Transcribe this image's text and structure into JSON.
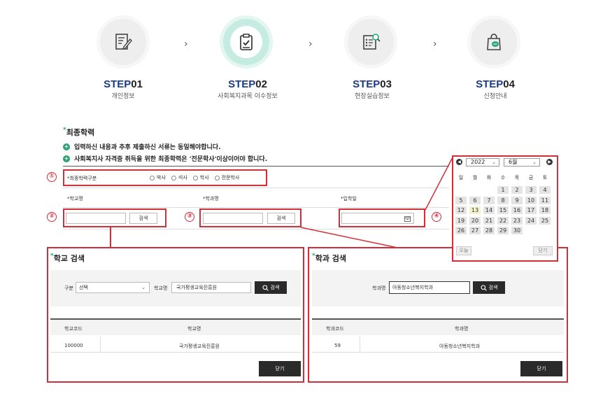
{
  "steps": [
    {
      "label": "STEP",
      "num": "01",
      "sub": "개인정보",
      "icon": "edit-document-icon"
    },
    {
      "label": "STEP",
      "num": "02",
      "sub": "사회복지과목 이수정보",
      "icon": "clipboard-check-icon"
    },
    {
      "label": "STEP",
      "num": "03",
      "sub": "현장실습정보",
      "icon": "document-search-icon"
    },
    {
      "label": "STEP",
      "num": "04",
      "sub": "신청안내",
      "icon": "shopping-bag-chat-icon"
    }
  ],
  "step_chevron": "›",
  "section": {
    "title": "최종학력",
    "required_mark": "*",
    "notices": [
      "입력하신 내용과 추후 제출하신 서류는 동일해야합니다.",
      "사회복지사 자격증 취득을 위한 최종학력은 '전문학사'이상이어야 합니다."
    ]
  },
  "form": {
    "degree_label": "*최종학력구분",
    "degree_options": [
      "박사",
      "석사",
      "학사",
      "전문학사"
    ],
    "school_label": "*학교명",
    "major_label": "*학과명",
    "admission_label": "*입학일",
    "search_btn": "검색",
    "callouts": [
      "①",
      "②",
      "③",
      "④"
    ]
  },
  "school_search": {
    "title": "학교 검색",
    "type_label": "구분",
    "type_value": "선택",
    "name_label": "학교명",
    "name_value": "국가평생교육진흥원",
    "search_btn": "검색",
    "columns": [
      "학교코드",
      "학교명"
    ],
    "rows": [
      {
        "code": "100000",
        "name": "국가평생교육진흥원"
      }
    ],
    "close_btn": "닫기"
  },
  "major_search": {
    "title": "학과 검색",
    "name_label": "학과명",
    "name_value": "아동청소년복지학과",
    "search_btn": "검색",
    "columns": [
      "학과코드",
      "학과명"
    ],
    "rows": [
      {
        "code": "59",
        "name": "아동청소년복지학과"
      }
    ],
    "close_btn": "닫기"
  },
  "calendar": {
    "year": "2022",
    "month": "6월",
    "weekdays": [
      "일",
      "월",
      "화",
      "수",
      "목",
      "금",
      "토"
    ],
    "days": [
      "1",
      "2",
      "3",
      "4",
      "5",
      "6",
      "7",
      "8",
      "9",
      "10",
      "11",
      "12",
      "13",
      "14",
      "15",
      "16",
      "17",
      "18",
      "19",
      "20",
      "21",
      "22",
      "23",
      "24",
      "25",
      "26",
      "27",
      "28",
      "29",
      "30"
    ],
    "first_weekday": 3,
    "today": "13",
    "today_btn": "오늘",
    "close_btn": "닫기"
  },
  "colors": {
    "accent": "#1a3a8a",
    "callout": "#d32f3a",
    "green": "#29a26f"
  }
}
